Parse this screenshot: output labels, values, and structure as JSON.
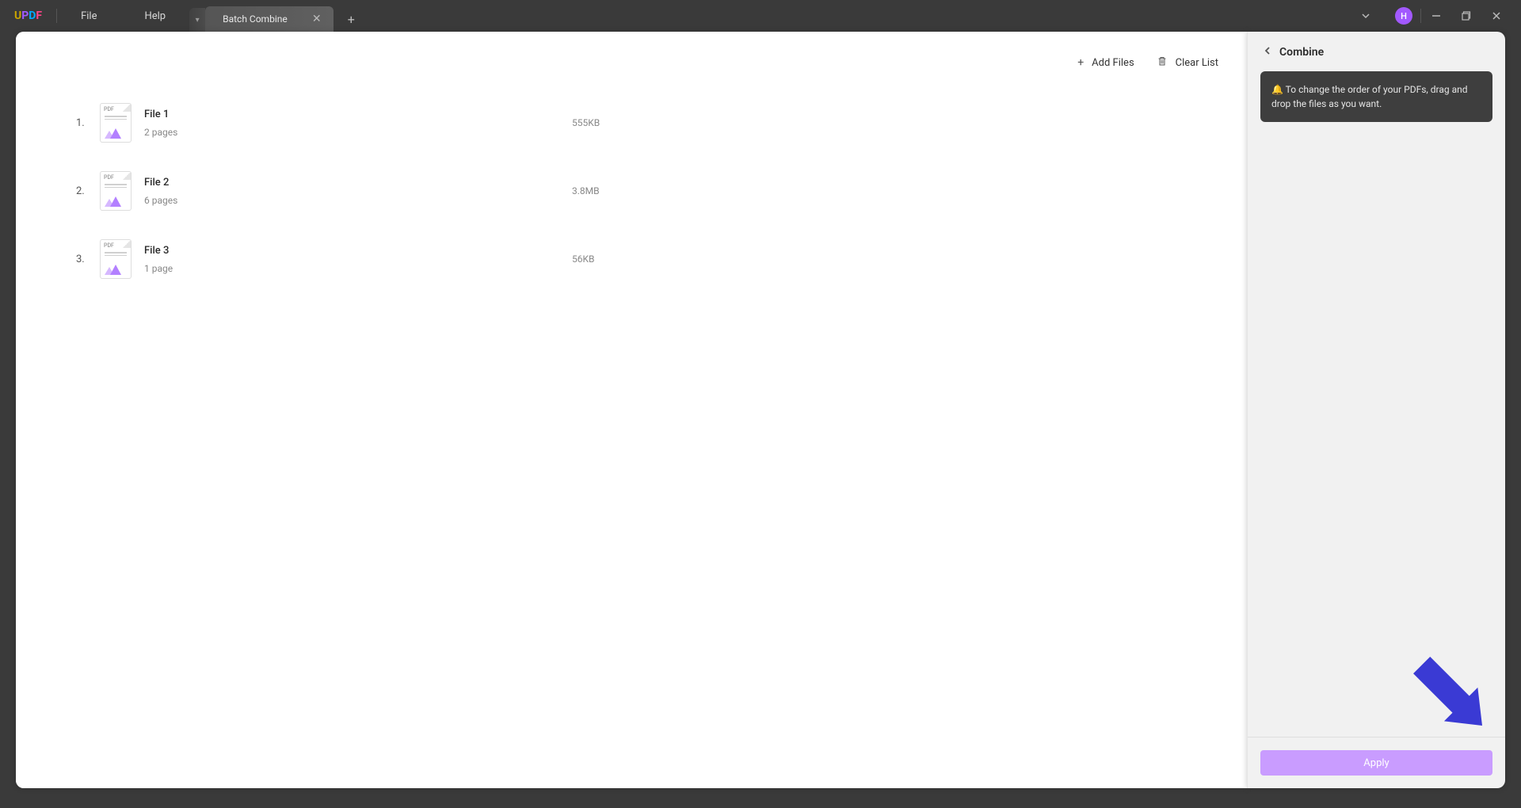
{
  "app": {
    "logo": {
      "u": "U",
      "p": "P",
      "d": "D",
      "f": "F"
    }
  },
  "menu": {
    "file": "File",
    "help": "Help"
  },
  "tab": {
    "title": "Batch Combine"
  },
  "avatar": {
    "initial": "H"
  },
  "toolbar": {
    "addFiles": "Add Files",
    "clearList": "Clear List"
  },
  "files": [
    {
      "idx": "1.",
      "name": "File 1",
      "pages": "2 pages",
      "size": "555KB"
    },
    {
      "idx": "2.",
      "name": "File 2",
      "pages": "6 pages",
      "size": "3.8MB"
    },
    {
      "idx": "3.",
      "name": "File 3",
      "pages": "1 page",
      "size": "56KB"
    }
  ],
  "side": {
    "title": "Combine",
    "tip": "🔔 To change the order of your PDFs, drag and drop the files as you want.",
    "apply": "Apply"
  }
}
